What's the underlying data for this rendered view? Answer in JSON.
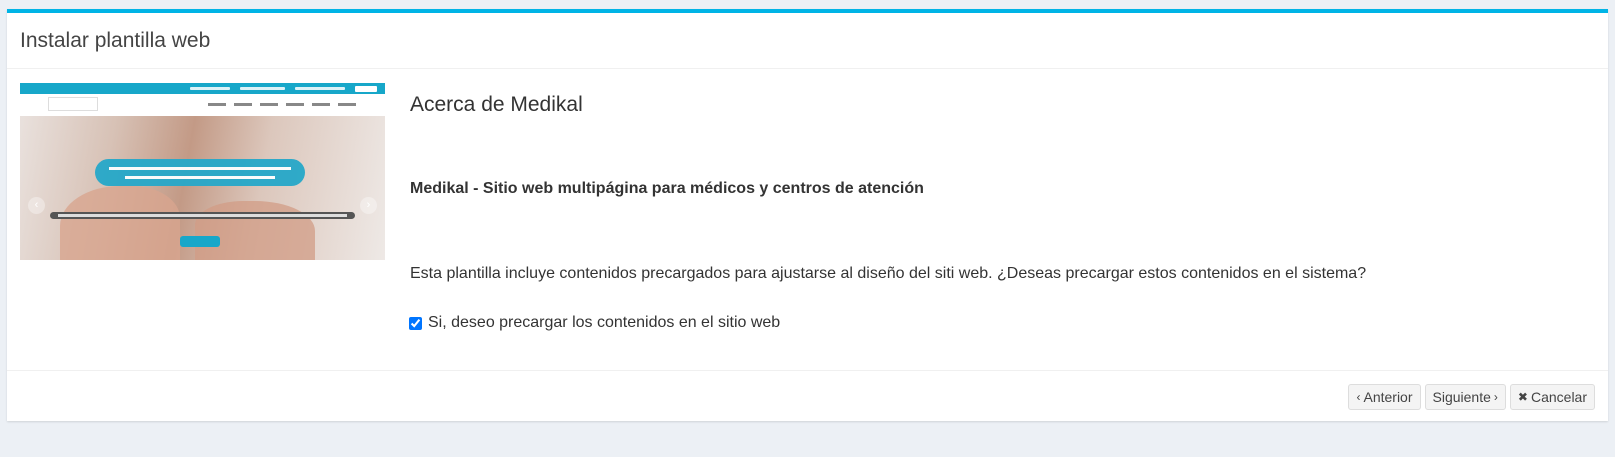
{
  "header": {
    "title": "Instalar plantilla web"
  },
  "template": {
    "about_title": "Acerca de Medikal",
    "product_name": "Medikal - Sitio web multipágina para médicos y centros de atención",
    "question": "Esta plantilla incluye contenidos precargados para ajustarse al diseño del siti web. ¿Deseas precargar estos contenidos en el sistema?",
    "preload_label": "Si, deseo precargar los contenidos en el sitio web",
    "preload_checked": true,
    "preview_image": "template-preview-thumbnail"
  },
  "footer": {
    "buttons": [
      {
        "label": "Anterior",
        "icon": "chevron-left-icon"
      },
      {
        "label": "Siguiente",
        "icon": "chevron-right-icon"
      },
      {
        "label": "Cancelar",
        "icon": "times-icon"
      }
    ]
  },
  "colors": {
    "accent": "#00b4e6",
    "page_bg": "#ecf0f5",
    "button_bg": "#f4f4f4"
  }
}
